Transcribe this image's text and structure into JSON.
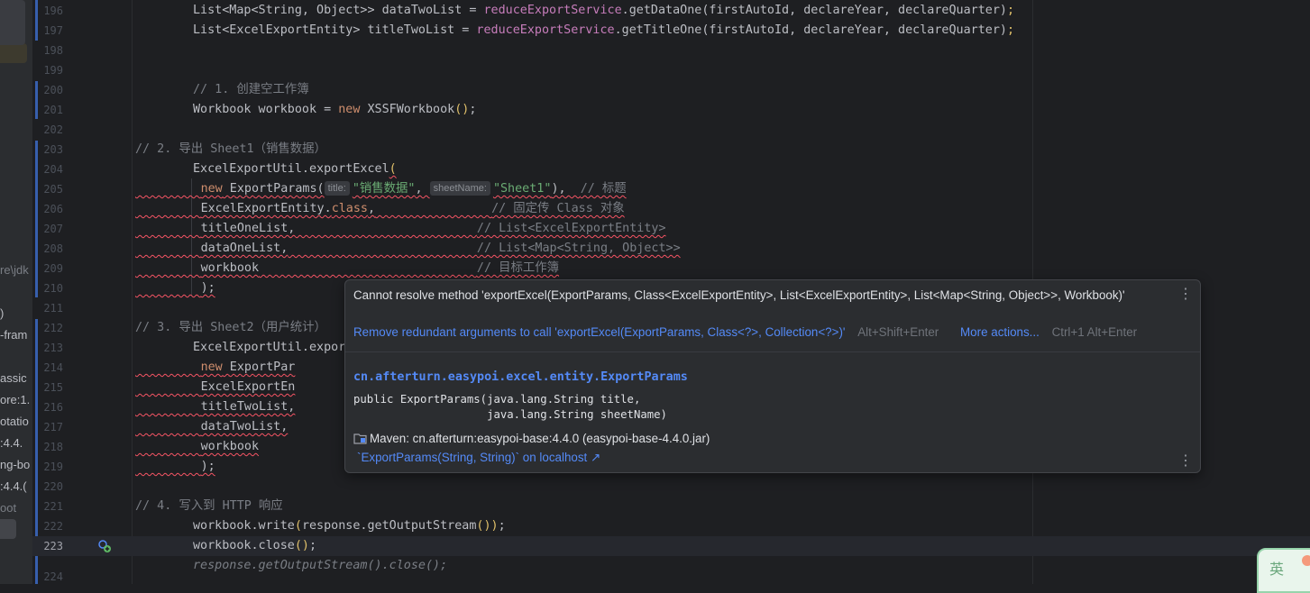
{
  "colors": {
    "accent": "#548af7",
    "error": "#f75464",
    "string": "#6aab73",
    "keyword": "#cf8e6d",
    "field": "#c77dbb"
  },
  "left_panel": {
    "fragments": [
      "re\\jdk",
      ")",
      "-fram",
      "assic",
      "ore:1.",
      "otatio",
      ":4.4.",
      "ng-bo",
      ":4.4.(",
      "oot"
    ]
  },
  "editor": {
    "line_numbers": [
      "196",
      "197",
      "198",
      "199",
      "200",
      "201",
      "202",
      "203",
      "204",
      "205",
      "206",
      "207",
      "208",
      "209",
      "210",
      "211",
      "212",
      "213",
      "214",
      "215",
      "216",
      "217",
      "218",
      "219",
      "220",
      "221",
      "222",
      "223",
      "224"
    ],
    "l196": {
      "a": "List<Map<String, Object>> dataTwoList = ",
      "svc": "reduceExportService",
      "b": ".getDataOne(firstAutoId, declareYear, declareQuarter)",
      "c": ";"
    },
    "l197": {
      "a": "List<ExcelExportEntity> titleTwoList = ",
      "svc": "reduceExportService",
      "b": ".getTitleOne(firstAutoId, declareYear, declareQuarter)",
      "c": ";"
    },
    "l200": {
      "cmt": "// 1. 创建空工作簿"
    },
    "l201": {
      "a": "Workbook workbook = ",
      "kw": "new",
      "b": " XSSFWorkbook",
      "br": "()",
      "c": ";"
    },
    "l203": {
      "cmt": "// 2. 导出 Sheet1（销售数据）"
    },
    "l204": {
      "a": "ExcelExportUtil.exportExcel",
      "br": "("
    },
    "l205": {
      "kw": "new",
      "a": " ExportParams(",
      "hint1": "title:",
      "str1": "\"销售数据\"",
      "b": ", ",
      "hint2": "sheetName:",
      "str2": "\"Sheet1\"",
      "c": "),  ",
      "cmt": "// 标题"
    },
    "l206": {
      "a": "ExcelExportEntity.",
      "kw": "class",
      "b": ",",
      "cmt": "// 固定传 Class 对象"
    },
    "l207": {
      "a": "titleOneList,",
      "cmt": "// List<ExcelExportEntity>"
    },
    "l208": {
      "a": "dataOneList,",
      "cmt": "// List<Map<String, Object>>"
    },
    "l209": {
      "a": "workbook",
      "cmt": "// 目标工作簿"
    },
    "l210": {
      "a": ");"
    },
    "l212": {
      "cmt": "// 3. 导出 Sheet2（用户统计）"
    },
    "l213": {
      "a": "ExcelExportUtil.expor"
    },
    "l214": {
      "kw": "new",
      "a": " ExportPar"
    },
    "l215": {
      "a": "ExcelExportEn"
    },
    "l216": {
      "a": "titleTwoList,"
    },
    "l217": {
      "a": "dataTwoList,"
    },
    "l218": {
      "a": "workbook"
    },
    "l219": {
      "a": ");"
    },
    "l221": {
      "cmt": "// 4. 写入到 HTTP 响应"
    },
    "l222": {
      "a": "workbook.write",
      "br1": "(",
      "b": "response.getOutputStream",
      "br2": "()",
      "br3": ")",
      "c": ";"
    },
    "l223": {
      "a": "workbook.close",
      "br": "()",
      "c": ";"
    },
    "l224": {
      "cmt": "response.getOutputStream().close();"
    }
  },
  "popup": {
    "message": "Cannot resolve method 'exportExcel(ExportParams, Class<ExcelExportEntity>, List<ExcelExportEntity>, List<Map<String, Object>>, Workbook)'",
    "quick_fix": "Remove redundant arguments to call 'exportExcel(ExportParams, Class<?>, Collection<?>)'",
    "quick_fix_shortcut": "Alt+Shift+Enter",
    "more_actions": "More actions...",
    "more_actions_shortcut": "Ctrl+1 Alt+Enter",
    "fqn": "cn.afterturn.easypoi.excel.entity.ExportParams",
    "signature_line1": "public ExportParams(java.lang.String title,",
    "signature_line2": "                    java.lang.String sheetName)",
    "maven": "Maven: cn.afterturn:easypoi-base:4.4.0 (easypoi-base-4.4.0.jar)",
    "external_link": "`ExportParams(String, String)` on localhost ↗"
  },
  "ime": {
    "label": "英"
  }
}
